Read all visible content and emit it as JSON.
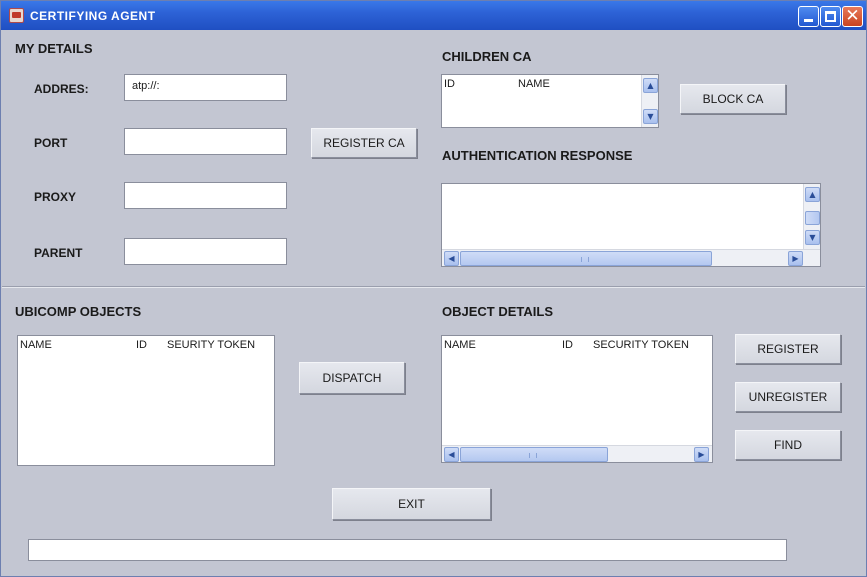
{
  "window": {
    "title": "CERTIFYING AGENT",
    "icons": {
      "app": "app-icon",
      "minimize": "minimize-icon",
      "maximize": "maximize-icon",
      "close": "close-icon",
      "close_glyph": "✕"
    }
  },
  "my_details": {
    "heading": "MY DETAILS",
    "address_label": "ADDRES:",
    "address_value": "atp://:",
    "port_label": "PORT",
    "port_value": "",
    "proxy_label": "PROXY",
    "proxy_value": "",
    "parent_label": "PARENT",
    "parent_value": "",
    "register_ca_button": "REGISTER CA"
  },
  "children_ca": {
    "heading": "CHILDREN CA",
    "columns": [
      "ID",
      "NAME"
    ],
    "rows": [],
    "block_ca_button": "BLOCK CA"
  },
  "authentication_response": {
    "heading": "AUTHENTICATION RESPONSE",
    "text": ""
  },
  "ubicomp_objects": {
    "heading": "UBICOMP OBJECTS",
    "columns": [
      "NAME",
      "ID",
      "SEURITY TOKEN"
    ],
    "rows": [],
    "dispatch_button": "DISPATCH"
  },
  "object_details": {
    "heading": "OBJECT DETAILS",
    "columns": [
      "NAME",
      "ID",
      "SECURITY TOKEN"
    ],
    "rows": [],
    "register_button": "REGISTER",
    "unregister_button": "UNREGISTER",
    "find_button": "FIND"
  },
  "footer": {
    "exit_button": "EXIT",
    "status_text": ""
  },
  "scroll_arrows": {
    "up": "▲",
    "down": "▼",
    "left": "◀",
    "right": "▶"
  },
  "colors": {
    "window_bg": "#c3c6d2",
    "titlebar": "#2d62d6",
    "close_button": "#c9431f",
    "scrollbar_accent": "#a9c0ee"
  }
}
